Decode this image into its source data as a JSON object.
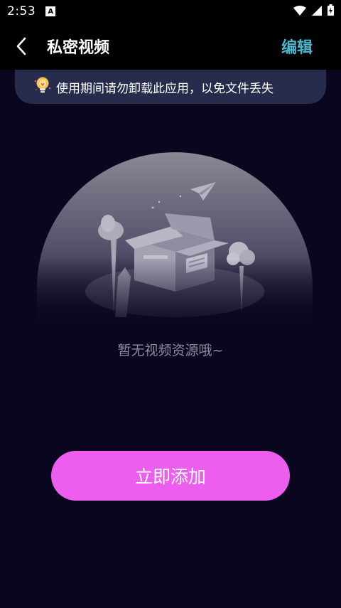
{
  "status_bar": {
    "time": "2:53",
    "app_icon_letter": "A"
  },
  "header": {
    "title": "私密视频",
    "edit_label": "编辑",
    "accent_color": "#49b6cc"
  },
  "notice": {
    "text": "使用期间请勿卸载此应用，以免文件丢失"
  },
  "empty_state": {
    "message": "暂无视频资源哦~"
  },
  "add_button": {
    "label": "立即添加",
    "color": "#ee5eee"
  }
}
